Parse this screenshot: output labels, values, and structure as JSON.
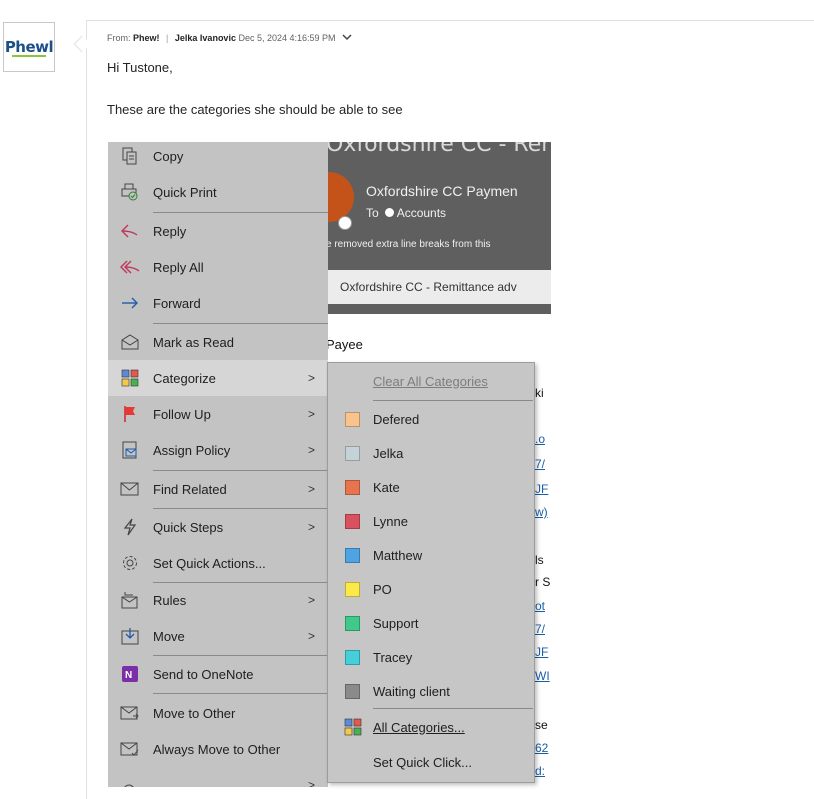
{
  "sender": {
    "logo_text": "Phewl",
    "from_prefix": "From:",
    "from_org": "Phew!",
    "separator": "|",
    "from_name": "Jelka Ivanovic",
    "date": "Dec 5, 2024 4:16:59 PM"
  },
  "message": {
    "greeting": "Hi Tustone,",
    "body": "These are the categories she should be able to see"
  },
  "embedded_screenshot": {
    "title_fragment": "Oxfordshire CC - Remittan",
    "sender": "Oxfordshire CC Paymen",
    "to_label": "To",
    "to_recipient": "Accounts",
    "note": "e removed extra line breaks from this",
    "subject": "Oxfordshire CC - Remittance adv",
    "payee": "Payee",
    "fragments": [
      "ki",
      ".o",
      "7/",
      "JF",
      "w)",
      "ls",
      "r S",
      "ot",
      "7/",
      "JF",
      "WI",
      "se",
      "62",
      "d:"
    ]
  },
  "context_menu": {
    "items": [
      {
        "label": "Copy",
        "icon": "copy-icon"
      },
      {
        "label": "Quick Print",
        "icon": "quick-print-icon"
      },
      {
        "label": "Reply",
        "icon": "reply-icon"
      },
      {
        "label": "Reply All",
        "icon": "reply-all-icon"
      },
      {
        "label": "Forward",
        "icon": "forward-icon"
      },
      {
        "label": "Mark as Read",
        "icon": "envelope-open-icon"
      },
      {
        "label": "Categorize",
        "icon": "categorize-icon",
        "submenu": true
      },
      {
        "label": "Follow Up",
        "icon": "flag-icon",
        "submenu": true
      },
      {
        "label": "Assign Policy",
        "icon": "policy-icon",
        "submenu": true
      },
      {
        "label": "Find Related",
        "icon": "find-related-icon",
        "submenu": true
      },
      {
        "label": "Quick Steps",
        "icon": "lightning-icon",
        "submenu": true
      },
      {
        "label": "Set Quick Actions...",
        "icon": "gear-icon"
      },
      {
        "label": "Rules",
        "icon": "rules-icon",
        "submenu": true
      },
      {
        "label": "Move",
        "icon": "move-icon",
        "submenu": true
      },
      {
        "label": "Send to OneNote",
        "icon": "onenote-icon"
      },
      {
        "label": "Move to Other",
        "icon": "move-to-other-icon"
      },
      {
        "label": "Always Move to Other",
        "icon": "always-move-icon"
      }
    ],
    "submenu_arrow": ">"
  },
  "categorize_submenu": {
    "clear_label": "Clear All Categories",
    "categories": [
      {
        "name": "Defered",
        "color": "#f9c38d"
      },
      {
        "name": "Jelka",
        "color": "#c5d2d8"
      },
      {
        "name": "Kate",
        "color": "#e8744f"
      },
      {
        "name": "Lynne",
        "color": "#d9505f"
      },
      {
        "name": "Matthew",
        "color": "#4fa3e3"
      },
      {
        "name": "PO",
        "color": "#fbe94a"
      },
      {
        "name": "Support",
        "color": "#3fc98a"
      },
      {
        "name": "Tracey",
        "color": "#45cfd8"
      },
      {
        "name": "Waiting client",
        "color": "#8a8a8a"
      }
    ],
    "all_label": "All Categories...",
    "quick_click_label": "Set Quick Click..."
  }
}
